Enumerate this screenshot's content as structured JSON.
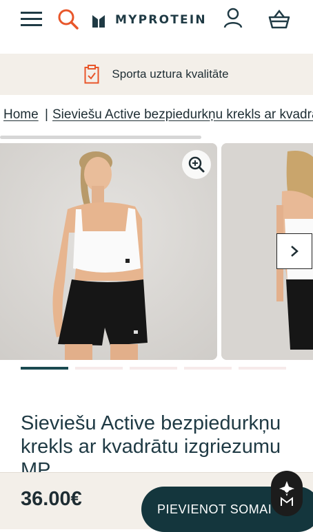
{
  "header": {
    "brand": "MYPROTEIN",
    "icons": [
      "menu-icon",
      "search-icon",
      "account-icon",
      "basket-icon"
    ],
    "search_color": "#e8562a"
  },
  "promo": {
    "icon": "clipboard-check-icon",
    "text": "Sporta uztura kvalitāte",
    "icon_color": "#e8562a"
  },
  "breadcrumb": {
    "home": "Home",
    "separator": "|",
    "current": "Sieviešu Active bezpiedurkņu krekls ar kvadrātu izgriezumu MP"
  },
  "gallery": {
    "slides": [
      "model-front-photo",
      "model-back-photo"
    ],
    "zoom_icon": "zoom-in-icon",
    "next_icon": "chevron-right-icon",
    "dot_count": 5,
    "active_dot": 1
  },
  "product": {
    "title": "Sieviešu Active bezpiedurkņu krekls ar kvadrātu izgriezumu MP",
    "price": "36.00€",
    "add_to_bag_label": "PIEVIENOT SOMAI"
  },
  "colors": {
    "brand_dark": "#14363d",
    "accent": "#e8562a",
    "promo_bg": "#f3efe9"
  }
}
